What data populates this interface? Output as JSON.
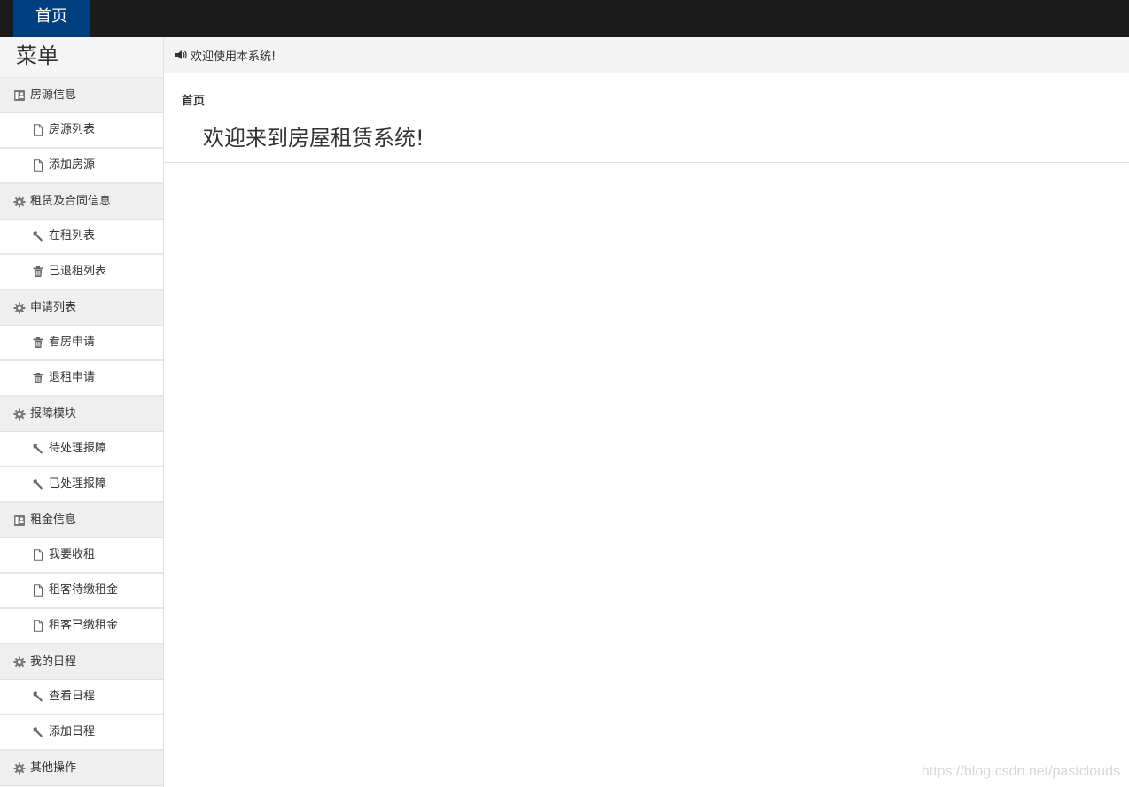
{
  "topbar": {
    "home_tab": "首页"
  },
  "sidebar": {
    "title": "菜单",
    "groups": [
      {
        "label": "房源信息",
        "icon": "address-card-icon",
        "items": [
          {
            "label": "房源列表",
            "icon": "file-icon"
          },
          {
            "label": "添加房源",
            "icon": "file-icon"
          }
        ]
      },
      {
        "label": "租赁及合同信息",
        "icon": "gear-icon",
        "items": [
          {
            "label": "在租列表",
            "icon": "wrench-icon"
          },
          {
            "label": "已退租列表",
            "icon": "trash-icon"
          }
        ]
      },
      {
        "label": "申请列表",
        "icon": "gear-icon",
        "items": [
          {
            "label": "看房申请",
            "icon": "trash-icon"
          },
          {
            "label": "退租申请",
            "icon": "trash-icon"
          }
        ]
      },
      {
        "label": "报障模块",
        "icon": "gear-icon",
        "items": [
          {
            "label": "待处理报障",
            "icon": "wrench-icon"
          },
          {
            "label": "已处理报障",
            "icon": "wrench-icon"
          }
        ]
      },
      {
        "label": "租金信息",
        "icon": "address-card-icon",
        "items": [
          {
            "label": "我要收租",
            "icon": "file-icon"
          },
          {
            "label": "租客待缴租金",
            "icon": "file-icon"
          },
          {
            "label": "租客已缴租金",
            "icon": "file-icon"
          }
        ]
      },
      {
        "label": "我的日程",
        "icon": "gear-icon",
        "items": [
          {
            "label": "查看日程",
            "icon": "wrench-icon"
          },
          {
            "label": "添加日程",
            "icon": "wrench-icon"
          }
        ]
      },
      {
        "label": "其他操作",
        "icon": "gear-icon",
        "items": []
      }
    ]
  },
  "main": {
    "notice": "欢迎使用本系统!",
    "notice_icon": "volume-icon",
    "breadcrumb": "首页",
    "welcome": "欢迎来到房屋租赁系统!"
  },
  "watermark": "https://blog.csdn.net/pastclouds",
  "colors": {
    "topbar": "#1b1b1b",
    "active_tab": "#003f7f",
    "icon_gray": "#777777"
  }
}
